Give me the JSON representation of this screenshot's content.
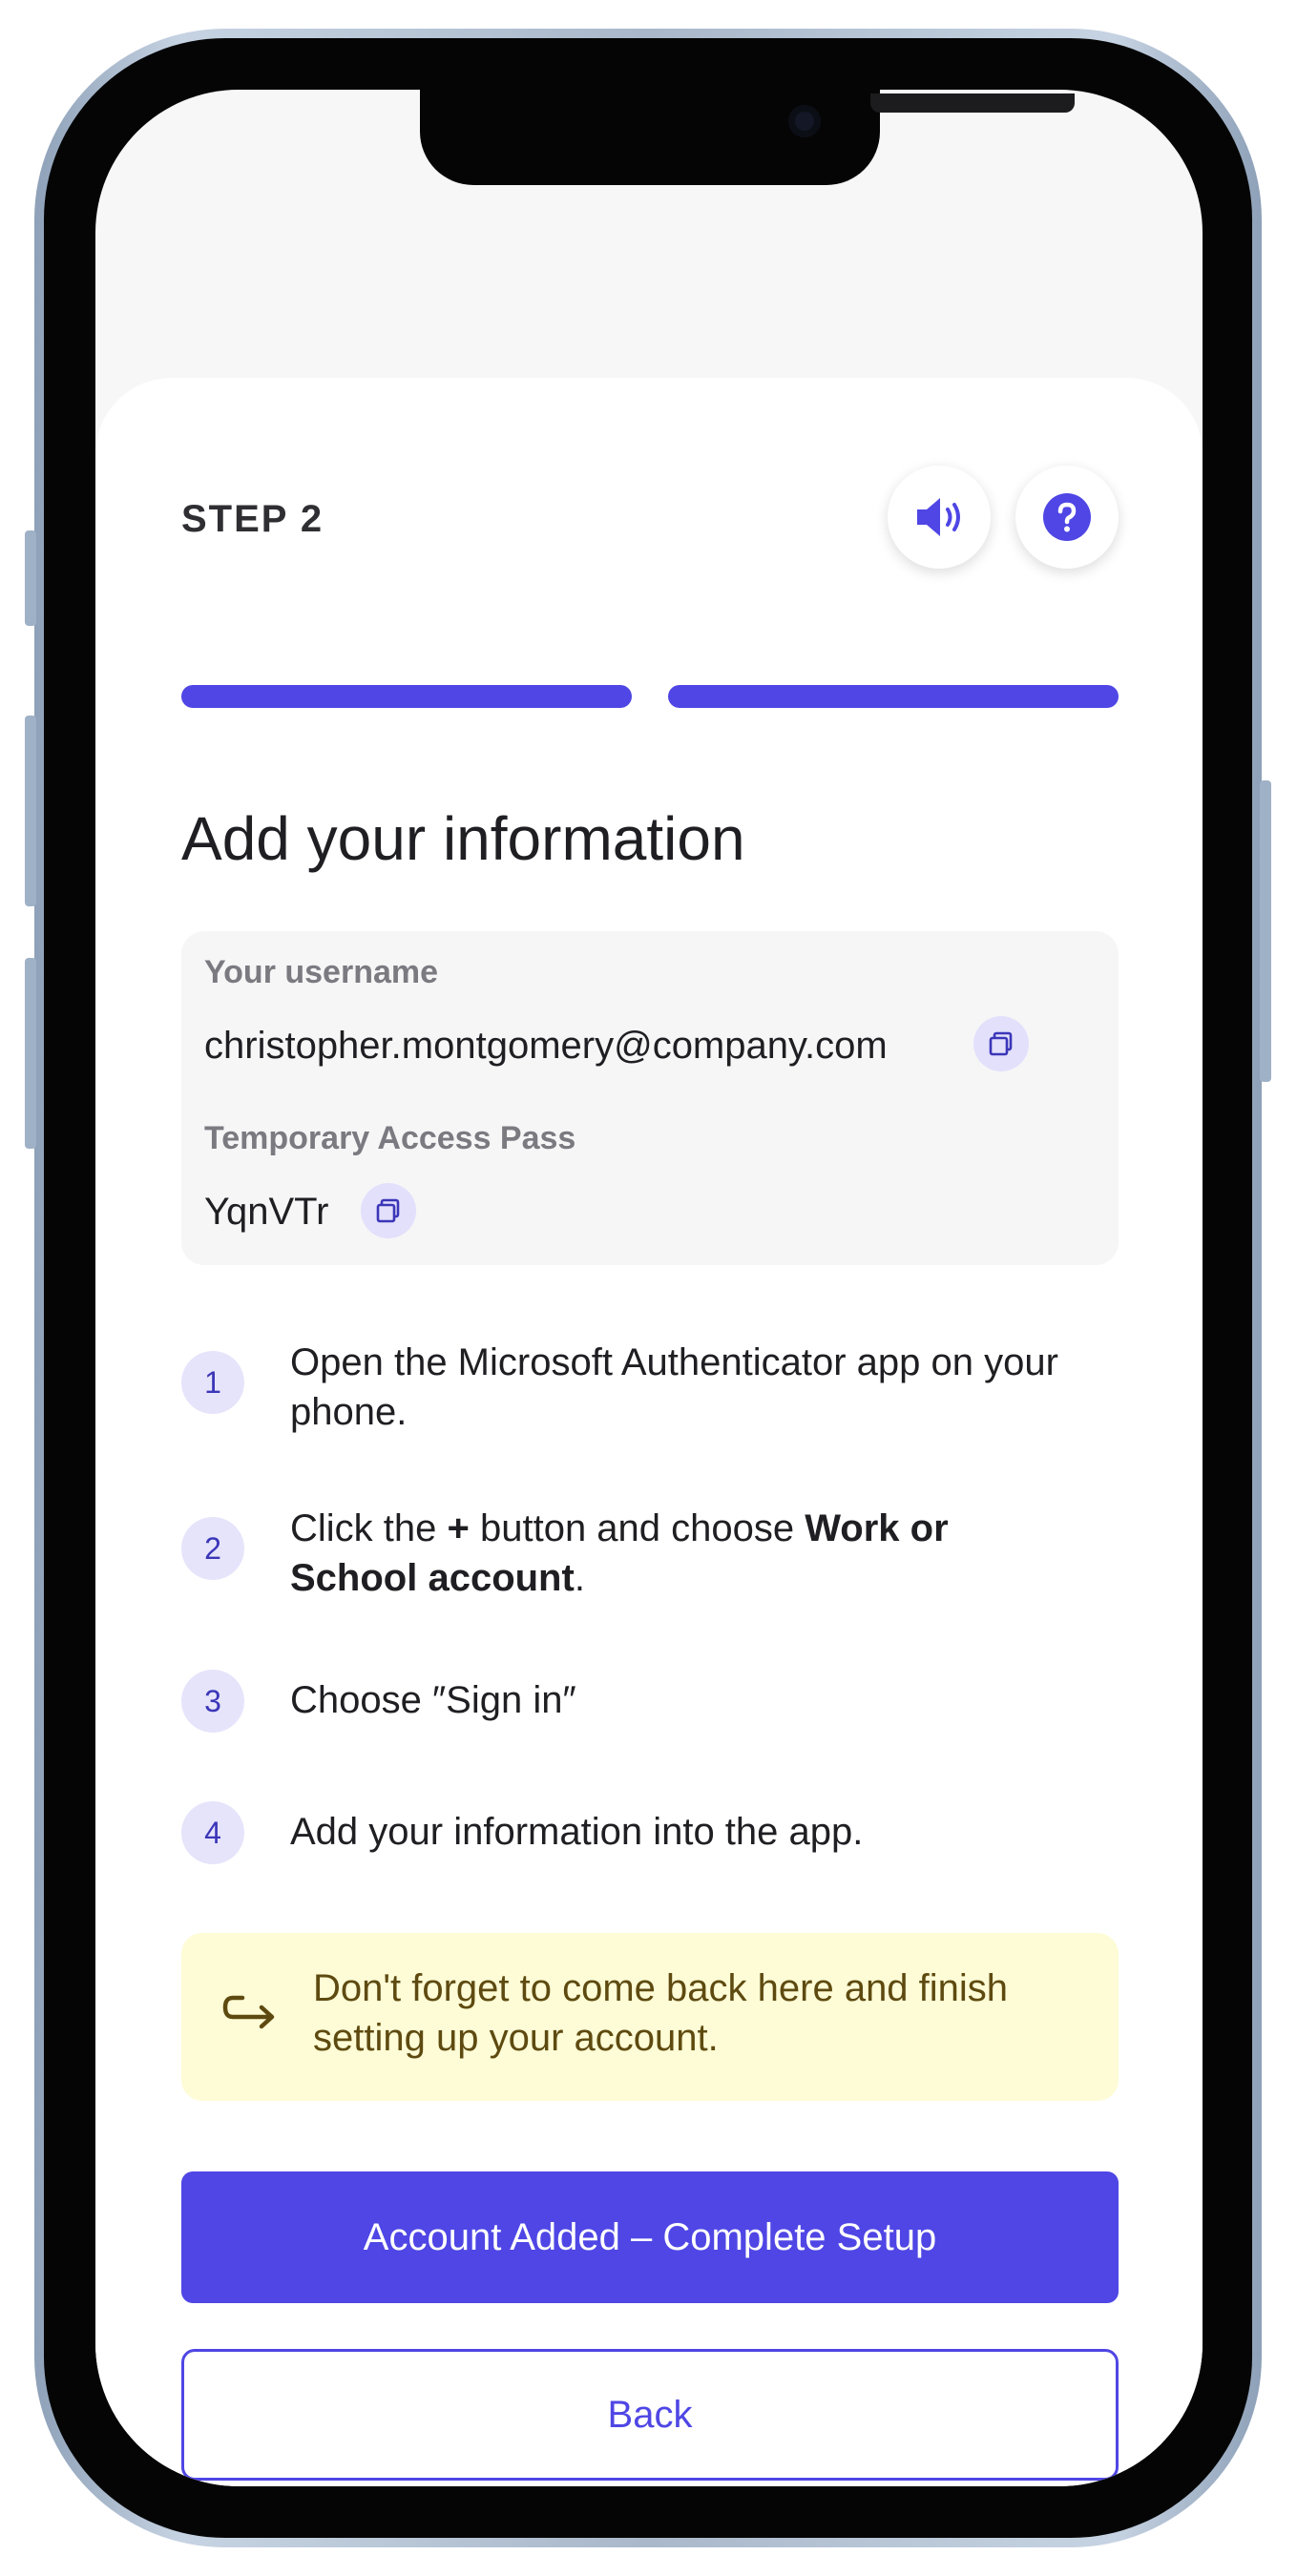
{
  "header": {
    "step_label": "STEP 2",
    "progress_segments": [
      1,
      1
    ]
  },
  "page": {
    "title": "Add your information"
  },
  "credentials": {
    "username_label": "Your username",
    "username_value": "christopher.montgomery@company.com",
    "pass_label": "Temporary Access Pass",
    "pass_value": "YqnVTr"
  },
  "steps": [
    {
      "number": "1",
      "text": "Open the Microsoft Authenticator app on your phone."
    },
    {
      "number": "2",
      "parts": [
        "Click the ",
        "+",
        " button and choose ",
        "Work or School account",
        "."
      ]
    },
    {
      "number": "3",
      "text": "Choose ″Sign in″"
    },
    {
      "number": "4",
      "text": "Add your information into the app."
    }
  ],
  "reminder": {
    "text": "Don't forget to come back here and finish setting up your account."
  },
  "actions": {
    "primary_label": "Account Added – Complete Setup",
    "secondary_label": "Back"
  },
  "icons": {
    "audio": "speaker-icon",
    "help": "help-icon",
    "copy": "copy-icon",
    "reminder": "return-arrow-icon"
  },
  "colors": {
    "accent": "#4f46e5",
    "reminder_bg": "#fdfcd6",
    "reminder_text": "#5e4a10"
  }
}
